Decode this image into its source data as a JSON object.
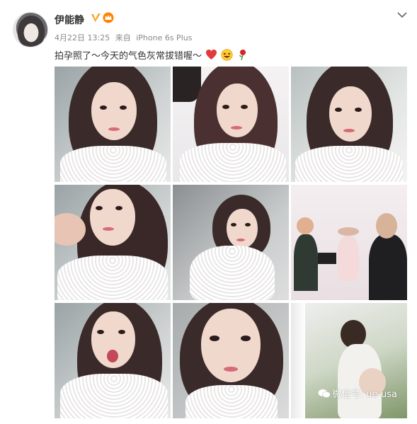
{
  "post": {
    "username": "伊能静",
    "date": "4月22日 13:25",
    "source_prefix": "来自",
    "source": "iPhone 6s Plus",
    "text": "拍孕照了～今天的气色灰常拔错喔～",
    "emoji_icons": [
      "heart-emoji-icon",
      "laughing-emoji-icon",
      "rose-emoji-icon"
    ]
  },
  "badges": {
    "verified_icon": "gold-v-verified-icon",
    "vip_icon": "vip-crown-icon"
  },
  "photos": [
    {
      "name": "photo-1"
    },
    {
      "name": "photo-2"
    },
    {
      "name": "photo-3"
    },
    {
      "name": "photo-4"
    },
    {
      "name": "photo-5"
    },
    {
      "name": "photo-6"
    },
    {
      "name": "photo-7"
    },
    {
      "name": "photo-8"
    },
    {
      "name": "photo-9"
    }
  ],
  "watermark": {
    "text": "微信号: ue-usa"
  },
  "colors": {
    "username": "#333333",
    "meta": "#888888",
    "badge_gold": "#f6a623",
    "vip_orange": "#ff8200"
  }
}
